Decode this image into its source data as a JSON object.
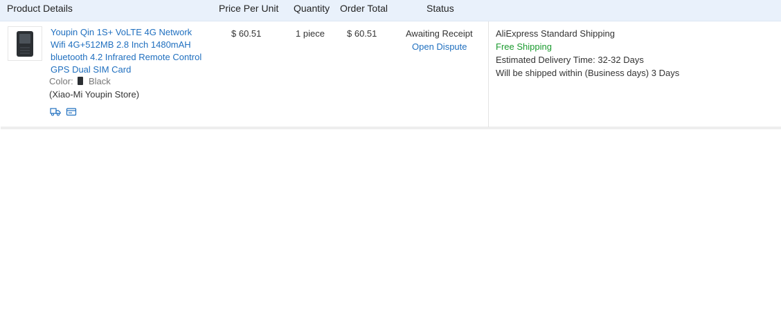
{
  "header": {
    "product_details": "Product Details",
    "price_per_unit": "Price Per Unit",
    "quantity": "Quantity",
    "order_total": "Order Total",
    "status": "Status"
  },
  "order": {
    "title_lines": [
      "Youpin Qin 1S+ VoLTE 4G Network",
      "Wifi 4G+512MB 2.8 Inch 1480mAH",
      "bluetooth 4.2 Infrared Remote Control",
      "GPS Dual SIM Card"
    ],
    "color_label": "Color:",
    "color_value": "Black",
    "store": "(Xiao-Mi Youpin Store)",
    "price": "$ 60.51",
    "quantity": "1 piece",
    "total": "$ 60.51",
    "status": "Awaiting Receipt",
    "dispute_link": "Open Dispute",
    "shipping": {
      "method": "AliExpress Standard Shipping",
      "cost": "Free Shipping",
      "delivery_label": "Estimated Delivery Time:",
      "delivery_value": "32-32 Days",
      "ship_within_label": "Will be shipped within (Business days)",
      "ship_within_value": "3 Days"
    },
    "icons": [
      "truck-icon",
      "card-icon"
    ]
  },
  "colors": {
    "header_bg": "#e9f1fb",
    "link": "#1f6fbf",
    "free_shipping": "#1a9a2e"
  }
}
